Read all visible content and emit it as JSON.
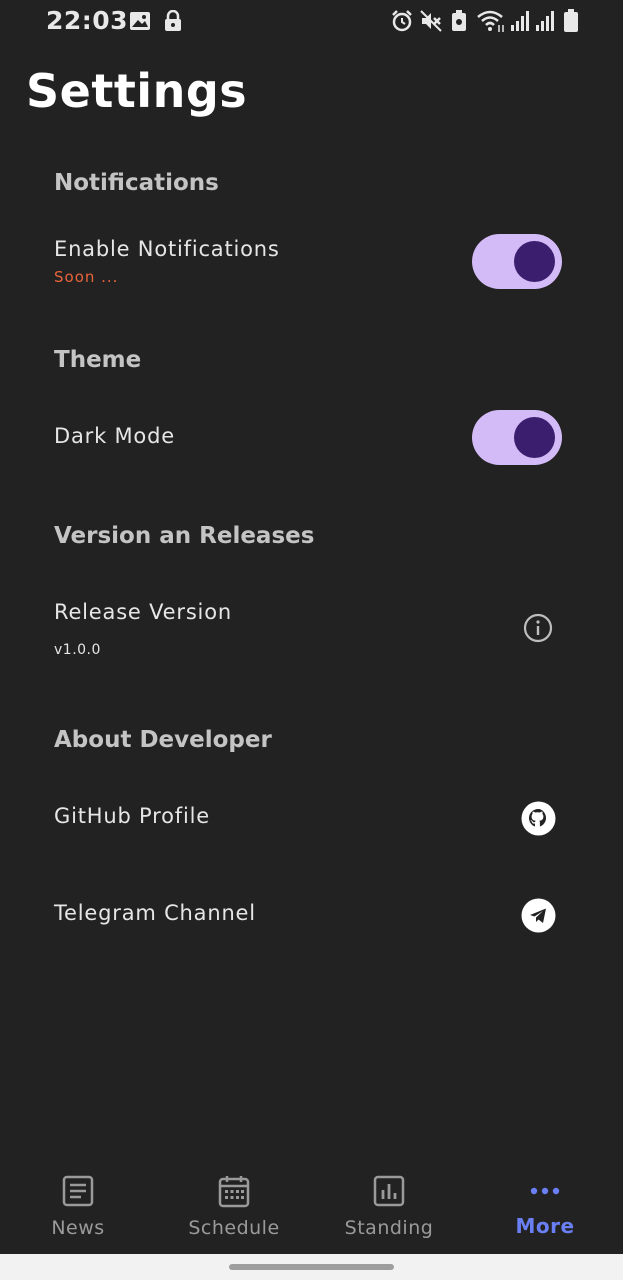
{
  "status_bar": {
    "time": "22:03"
  },
  "page": {
    "title": "Settings"
  },
  "sections": {
    "notifications": {
      "heading": "Notifications",
      "enable_label": "Enable Notifications",
      "enable_sub": "Soon ...",
      "enable_on": true
    },
    "theme": {
      "heading": "Theme",
      "dark_mode_label": "Dark Mode",
      "dark_mode_on": true
    },
    "version": {
      "heading": "Version an Releases",
      "release_label": "Release Version",
      "release_value": "v1.0.0"
    },
    "about": {
      "heading": "About Developer",
      "github_label": "GitHub Profile",
      "telegram_label": "Telegram Channel"
    }
  },
  "nav": {
    "items": [
      {
        "label": "News",
        "icon": "news-icon"
      },
      {
        "label": "Schedule",
        "icon": "calendar-icon"
      },
      {
        "label": "Standing",
        "icon": "bar-chart-icon"
      },
      {
        "label": "More",
        "icon": "more-dots-icon",
        "active": true
      }
    ]
  },
  "colors": {
    "background": "#222222",
    "accent": "#6b7ff5",
    "toggle_track": "#d3bbf7",
    "toggle_knob": "#3b1e6e",
    "soon_text": "#e8643a"
  }
}
